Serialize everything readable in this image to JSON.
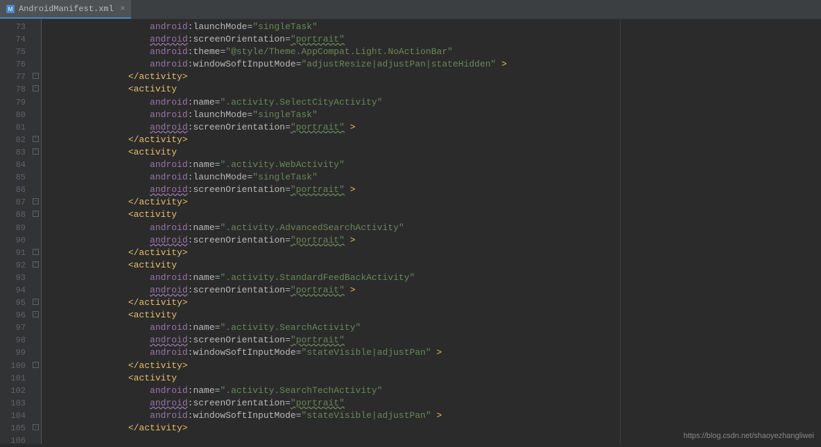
{
  "tab": {
    "filename": "AndroidManifest.xml"
  },
  "watermark": "https://blog.csdn.net/shaoyezhangliwei",
  "gutter": {
    "start": 73,
    "end": 106,
    "folds_open": [
      77,
      82,
      87,
      91,
      95,
      96
    ],
    "folds_close": [
      78,
      83,
      88,
      92,
      100,
      105
    ]
  },
  "code": [
    {
      "i": 4,
      "p": [
        {
          "t": "            ",
          "c": ""
        },
        {
          "t": "android",
          "c": "ns"
        },
        {
          "t": ":",
          "c": "attr"
        },
        {
          "t": "launchMode",
          "c": "attr"
        },
        {
          "t": "=",
          "c": "eq"
        },
        {
          "t": "\"singleTask\"",
          "c": "str"
        }
      ]
    },
    {
      "i": 4,
      "p": [
        {
          "t": "            ",
          "c": ""
        },
        {
          "t": "android",
          "c": "ns-u"
        },
        {
          "t": ":",
          "c": "attr"
        },
        {
          "t": "screenOrientation",
          "c": "attr"
        },
        {
          "t": "=",
          "c": "eq"
        },
        {
          "t": "\"portrait\"",
          "c": "str-u"
        }
      ]
    },
    {
      "i": 4,
      "p": [
        {
          "t": "            ",
          "c": ""
        },
        {
          "t": "android",
          "c": "ns"
        },
        {
          "t": ":",
          "c": "attr"
        },
        {
          "t": "theme",
          "c": "attr"
        },
        {
          "t": "=",
          "c": "eq"
        },
        {
          "t": "\"@style/Theme.AppCompat.Light.NoActionBar\"",
          "c": "str"
        }
      ]
    },
    {
      "i": 4,
      "p": [
        {
          "t": "            ",
          "c": ""
        },
        {
          "t": "android",
          "c": "ns"
        },
        {
          "t": ":",
          "c": "attr"
        },
        {
          "t": "windowSoftInputMode",
          "c": "attr"
        },
        {
          "t": "=",
          "c": "eq"
        },
        {
          "t": "\"adjustResize|adjustPan|stateHidden\"",
          "c": "str"
        },
        {
          "t": " >",
          "c": "bracket"
        }
      ]
    },
    {
      "i": 3,
      "p": [
        {
          "t": "        ",
          "c": ""
        },
        {
          "t": "</activity>",
          "c": "tag"
        }
      ]
    },
    {
      "i": 3,
      "p": [
        {
          "t": "        ",
          "c": ""
        },
        {
          "t": "<activity",
          "c": "tag"
        }
      ]
    },
    {
      "i": 4,
      "p": [
        {
          "t": "            ",
          "c": ""
        },
        {
          "t": "android",
          "c": "ns"
        },
        {
          "t": ":",
          "c": "attr"
        },
        {
          "t": "name",
          "c": "attr"
        },
        {
          "t": "=",
          "c": "eq"
        },
        {
          "t": "\".activity.SelectCityActivity\"",
          "c": "str"
        }
      ]
    },
    {
      "i": 4,
      "p": [
        {
          "t": "            ",
          "c": ""
        },
        {
          "t": "android",
          "c": "ns"
        },
        {
          "t": ":",
          "c": "attr"
        },
        {
          "t": "launchMode",
          "c": "attr"
        },
        {
          "t": "=",
          "c": "eq"
        },
        {
          "t": "\"singleTask\"",
          "c": "str"
        }
      ]
    },
    {
      "i": 4,
      "p": [
        {
          "t": "            ",
          "c": ""
        },
        {
          "t": "android",
          "c": "ns-u"
        },
        {
          "t": ":",
          "c": "attr"
        },
        {
          "t": "screenOrientation",
          "c": "attr"
        },
        {
          "t": "=",
          "c": "eq"
        },
        {
          "t": "\"portrait\"",
          "c": "str-u"
        },
        {
          "t": " >",
          "c": "bracket"
        }
      ]
    },
    {
      "i": 3,
      "p": [
        {
          "t": "        ",
          "c": ""
        },
        {
          "t": "</activity>",
          "c": "tag"
        }
      ]
    },
    {
      "i": 3,
      "p": [
        {
          "t": "        ",
          "c": ""
        },
        {
          "t": "<activity",
          "c": "tag"
        }
      ]
    },
    {
      "i": 4,
      "p": [
        {
          "t": "            ",
          "c": ""
        },
        {
          "t": "android",
          "c": "ns"
        },
        {
          "t": ":",
          "c": "attr"
        },
        {
          "t": "name",
          "c": "attr"
        },
        {
          "t": "=",
          "c": "eq"
        },
        {
          "t": "\".activity.WebActivity\"",
          "c": "str"
        }
      ]
    },
    {
      "i": 4,
      "p": [
        {
          "t": "            ",
          "c": ""
        },
        {
          "t": "android",
          "c": "ns"
        },
        {
          "t": ":",
          "c": "attr"
        },
        {
          "t": "launchMode",
          "c": "attr"
        },
        {
          "t": "=",
          "c": "eq"
        },
        {
          "t": "\"singleTask\"",
          "c": "str"
        }
      ]
    },
    {
      "i": 4,
      "p": [
        {
          "t": "            ",
          "c": ""
        },
        {
          "t": "android",
          "c": "ns-u"
        },
        {
          "t": ":",
          "c": "attr"
        },
        {
          "t": "screenOrientation",
          "c": "attr"
        },
        {
          "t": "=",
          "c": "eq"
        },
        {
          "t": "\"portrait\"",
          "c": "str-u"
        },
        {
          "t": " >",
          "c": "bracket"
        }
      ]
    },
    {
      "i": 3,
      "p": [
        {
          "t": "        ",
          "c": ""
        },
        {
          "t": "</activity>",
          "c": "tag"
        }
      ]
    },
    {
      "i": 3,
      "p": [
        {
          "t": "        ",
          "c": ""
        },
        {
          "t": "<activity",
          "c": "tag"
        }
      ]
    },
    {
      "i": 4,
      "p": [
        {
          "t": "            ",
          "c": ""
        },
        {
          "t": "android",
          "c": "ns"
        },
        {
          "t": ":",
          "c": "attr"
        },
        {
          "t": "name",
          "c": "attr"
        },
        {
          "t": "=",
          "c": "eq"
        },
        {
          "t": "\".activity.AdvancedSearchActivity\"",
          "c": "str"
        }
      ]
    },
    {
      "i": 4,
      "p": [
        {
          "t": "            ",
          "c": ""
        },
        {
          "t": "android",
          "c": "ns-u"
        },
        {
          "t": ":",
          "c": "attr"
        },
        {
          "t": "screenOrientation",
          "c": "attr"
        },
        {
          "t": "=",
          "c": "eq"
        },
        {
          "t": "\"portrait\"",
          "c": "str-u"
        },
        {
          "t": " >",
          "c": "bracket"
        }
      ]
    },
    {
      "i": 3,
      "p": [
        {
          "t": "        ",
          "c": ""
        },
        {
          "t": "</activity>",
          "c": "tag"
        }
      ]
    },
    {
      "i": 3,
      "p": [
        {
          "t": "        ",
          "c": ""
        },
        {
          "t": "<activity",
          "c": "tag"
        }
      ]
    },
    {
      "i": 4,
      "p": [
        {
          "t": "            ",
          "c": ""
        },
        {
          "t": "android",
          "c": "ns"
        },
        {
          "t": ":",
          "c": "attr"
        },
        {
          "t": "name",
          "c": "attr"
        },
        {
          "t": "=",
          "c": "eq"
        },
        {
          "t": "\".activity.StandardFeedBackActivity\"",
          "c": "str"
        }
      ]
    },
    {
      "i": 4,
      "p": [
        {
          "t": "            ",
          "c": ""
        },
        {
          "t": "android",
          "c": "ns-u"
        },
        {
          "t": ":",
          "c": "attr"
        },
        {
          "t": "screenOrientation",
          "c": "attr"
        },
        {
          "t": "=",
          "c": "eq"
        },
        {
          "t": "\"portrait\"",
          "c": "str-u"
        },
        {
          "t": " >",
          "c": "bracket"
        }
      ]
    },
    {
      "i": 3,
      "p": [
        {
          "t": "        ",
          "c": ""
        },
        {
          "t": "</activity>",
          "c": "tag"
        }
      ]
    },
    {
      "i": 3,
      "p": [
        {
          "t": "        ",
          "c": ""
        },
        {
          "t": "<activity",
          "c": "tag"
        }
      ]
    },
    {
      "i": 4,
      "p": [
        {
          "t": "            ",
          "c": ""
        },
        {
          "t": "android",
          "c": "ns"
        },
        {
          "t": ":",
          "c": "attr"
        },
        {
          "t": "name",
          "c": "attr"
        },
        {
          "t": "=",
          "c": "eq"
        },
        {
          "t": "\".activity.SearchActivity\"",
          "c": "str"
        }
      ]
    },
    {
      "i": 4,
      "p": [
        {
          "t": "            ",
          "c": ""
        },
        {
          "t": "android",
          "c": "ns-u"
        },
        {
          "t": ":",
          "c": "attr"
        },
        {
          "t": "screenOrientation",
          "c": "attr"
        },
        {
          "t": "=",
          "c": "eq"
        },
        {
          "t": "\"portrait\"",
          "c": "str-u"
        }
      ]
    },
    {
      "i": 4,
      "p": [
        {
          "t": "            ",
          "c": ""
        },
        {
          "t": "android",
          "c": "ns"
        },
        {
          "t": ":",
          "c": "attr"
        },
        {
          "t": "windowSoftInputMode",
          "c": "attr"
        },
        {
          "t": "=",
          "c": "eq"
        },
        {
          "t": "\"stateVisible|adjustPan\"",
          "c": "str"
        },
        {
          "t": " >",
          "c": "bracket"
        }
      ]
    },
    {
      "i": 3,
      "p": [
        {
          "t": "        ",
          "c": ""
        },
        {
          "t": "</activity>",
          "c": "tag"
        }
      ]
    },
    {
      "i": 3,
      "p": [
        {
          "t": "        ",
          "c": ""
        },
        {
          "t": "<activity",
          "c": "tag"
        }
      ]
    },
    {
      "i": 4,
      "p": [
        {
          "t": "            ",
          "c": ""
        },
        {
          "t": "android",
          "c": "ns"
        },
        {
          "t": ":",
          "c": "attr"
        },
        {
          "t": "name",
          "c": "attr"
        },
        {
          "t": "=",
          "c": "eq"
        },
        {
          "t": "\".activity.SearchTechActivity\"",
          "c": "str"
        }
      ]
    },
    {
      "i": 4,
      "p": [
        {
          "t": "            ",
          "c": ""
        },
        {
          "t": "android",
          "c": "ns-u"
        },
        {
          "t": ":",
          "c": "attr"
        },
        {
          "t": "screenOrientation",
          "c": "attr"
        },
        {
          "t": "=",
          "c": "eq"
        },
        {
          "t": "\"portrait\"",
          "c": "str-u"
        }
      ]
    },
    {
      "i": 4,
      "p": [
        {
          "t": "            ",
          "c": ""
        },
        {
          "t": "android",
          "c": "ns"
        },
        {
          "t": ":",
          "c": "attr"
        },
        {
          "t": "windowSoftInputMode",
          "c": "attr"
        },
        {
          "t": "=",
          "c": "eq"
        },
        {
          "t": "\"stateVisible|adjustPan\"",
          "c": "str"
        },
        {
          "t": " >",
          "c": "bracket"
        }
      ]
    },
    {
      "i": 3,
      "p": [
        {
          "t": "        ",
          "c": ""
        },
        {
          "t": "</activity>",
          "c": "tag"
        }
      ]
    },
    {
      "i": 3,
      "p": [
        {
          "t": "        ",
          "c": ""
        }
      ]
    }
  ]
}
